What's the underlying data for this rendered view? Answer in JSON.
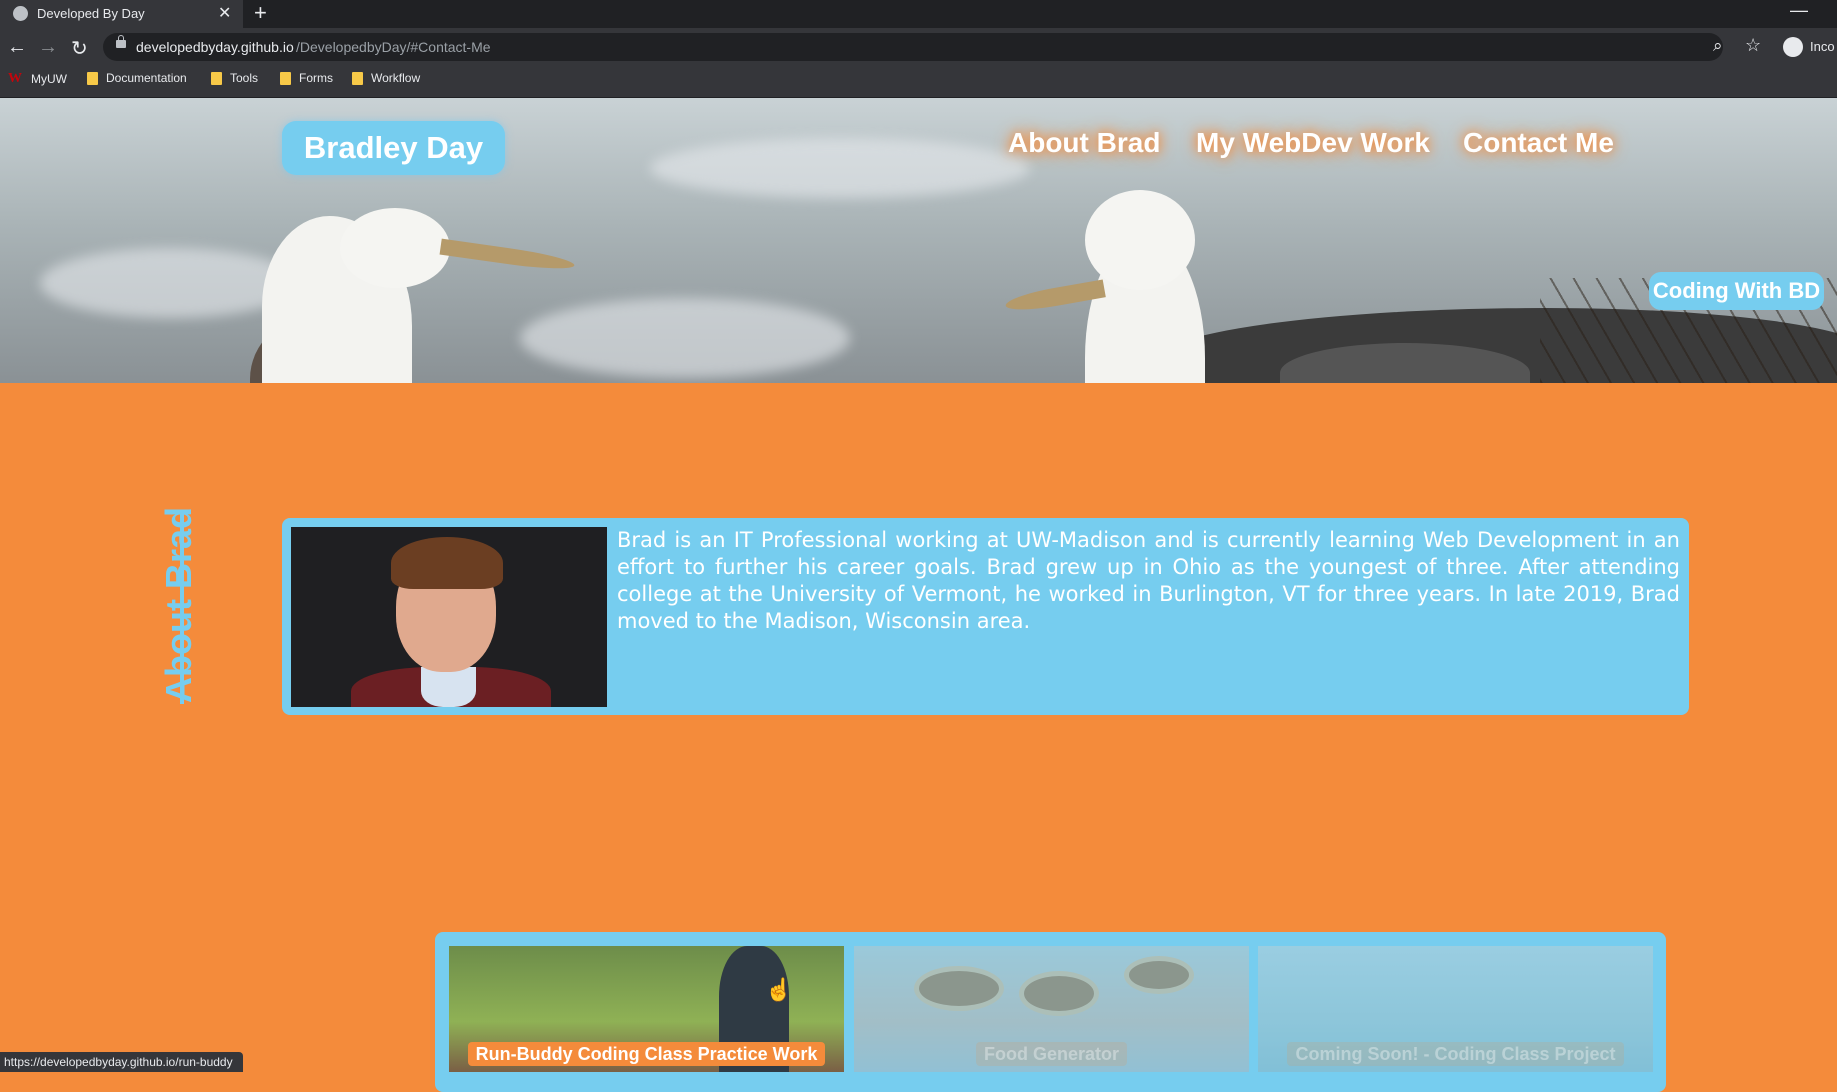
{
  "browser": {
    "tab_title": "Developed By Day",
    "tab_close": "✕",
    "new_tab": "+",
    "minimize": "—",
    "url_domain": "developedbyday.github.io",
    "url_path": "/DevelopedbyDay/#Contact-Me",
    "profile_label": "Inco",
    "bookmarks": [
      "MyUW",
      "Documentation",
      "Tools",
      "Forms",
      "Workflow"
    ],
    "status_url": "https://developedbyday.github.io/run-buddy"
  },
  "site": {
    "logo": "Bradley Day",
    "nav": [
      "About Brad",
      "My WebDev Work",
      "Contact Me"
    ],
    "badge": "Coding With BD"
  },
  "about": {
    "heading": "About Brad",
    "text": "Brad is an IT Professional working at UW-Madison and is currently learning Web Development in an effort to further his career goals. Brad grew up in Ohio as the youngest of three. After attending college at the University of Vermont, he worked in Burlington, VT for three years. In late 2019, Brad moved to the Madison, Wisconsin area."
  },
  "projects": [
    {
      "label": "Run-Buddy Coding Class Practice Work"
    },
    {
      "label": "Food Generator"
    },
    {
      "label": "Coming Soon! - Coding Class Project"
    }
  ],
  "colors": {
    "accent_blue": "#76cdef",
    "accent_orange": "#f48b3b"
  }
}
